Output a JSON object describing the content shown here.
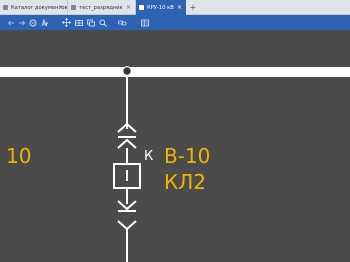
{
  "tabs": [
    {
      "label": "Каталог документов",
      "icon": "document-icon",
      "active": false
    },
    {
      "label": "тест_разрядник",
      "icon": "document-icon",
      "active": false
    },
    {
      "label": "КРУ-10 кВ",
      "icon": "document-icon",
      "active": true
    }
  ],
  "tab_close_glyph": "×",
  "tab_add_glyph": "+",
  "toolbar": {
    "icons": [
      "back-arrow-icon",
      "forward-arrow-icon",
      "zoom-out-icon",
      "text-size-icon",
      "move-icon",
      "grid-icon",
      "layers-icon",
      "search-icon",
      "link-icon",
      "table-icon"
    ]
  },
  "scheme": {
    "left_label": "10",
    "breaker_name": "В-10",
    "feeder_name": "КЛ2",
    "position_mark": "К",
    "accent_color": "#f0b400",
    "line_color": "#ffffff",
    "background_color": "#4b4b4b"
  }
}
